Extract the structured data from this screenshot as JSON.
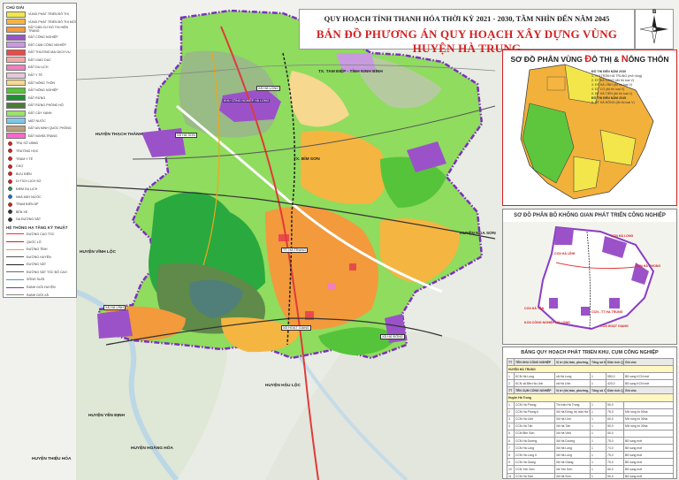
{
  "title": {
    "line1": "QUY HOẠCH TỈNH THANH HÓA THỜI KỲ 2021 - 2030, TẦM NHÌN ĐẾN NĂM 2045",
    "line2": "BẢN ĐỒ PHƯƠNG ÁN QUY HOẠCH XÂY DỰNG VÙNG HUYỆN HÀ TRUNG"
  },
  "compass": {
    "letter": "B"
  },
  "legend": {
    "heading": "CHÚ GIẢI",
    "zones": [
      {
        "label": "VÙNG PHÁT TRIỂN ĐÔ THỊ",
        "color": "#f2e64b"
      },
      {
        "label": "VÙNG PHÁT TRIỂN ĐÔ THỊ MỚI",
        "color": "#f5b541"
      },
      {
        "label": "ĐẤT DÂN CƯ ĐÔ THỊ HIỆN TRẠNG",
        "color": "#f29a3c"
      },
      {
        "label": "ĐẤT CÔNG NGHIỆP",
        "color": "#9b52c9"
      },
      {
        "label": "ĐẤT CỤM CÔNG NGHIỆP",
        "color": "#c99ae0"
      },
      {
        "label": "ĐẤT THƯƠNG MẠI DỊCH VỤ",
        "color": "#e94b4b"
      },
      {
        "label": "ĐẤT GIÁO DỤC",
        "color": "#f4a7a7"
      },
      {
        "label": "ĐẤT DU LỊCH",
        "color": "#f07fbd"
      },
      {
        "label": "ĐẤT Y TẾ",
        "color": "#e7c7d8"
      },
      {
        "label": "ĐẤT NÔNG THÔN",
        "color": "#f6d88f"
      },
      {
        "label": "ĐẤT NÔNG NGHIỆP",
        "color": "#55c43a"
      },
      {
        "label": "ĐẤT RỪNG",
        "color": "#1f8f33"
      },
      {
        "label": "ĐẤT RỪNG PHÒNG HỘ",
        "color": "#4f7a3a"
      },
      {
        "label": "ĐẤT CÂY XANH",
        "color": "#9be36a"
      },
      {
        "label": "MẶT NƯỚC",
        "color": "#7ec8e8"
      },
      {
        "label": "ĐẤT AN NINH QUỐC PHÒNG",
        "color": "#b9a07a"
      },
      {
        "label": "ĐẤT NGHĨA TRANG",
        "color": "#ff66cc"
      }
    ],
    "symbols": [
      {
        "label": "TRỤ SỞ UBND",
        "color": "#d42121"
      },
      {
        "label": "TRƯỜNG HỌC",
        "color": "#d42121"
      },
      {
        "label": "TRẠM Y TẾ",
        "color": "#d42121"
      },
      {
        "label": "CHỢ",
        "color": "#d42121"
      },
      {
        "label": "BƯU ĐIỆN",
        "color": "#d42121"
      },
      {
        "label": "DI TÍCH LỊCH SỬ",
        "color": "#d42121"
      },
      {
        "label": "ĐIỂM DU LỊCH",
        "color": "#2e8b57"
      },
      {
        "label": "NHÀ MÁY NƯỚC",
        "color": "#1c6fd6"
      },
      {
        "label": "TRẠM BIẾN ÁP",
        "color": "#d42121"
      },
      {
        "label": "BẾN XE",
        "color": "#333333"
      },
      {
        "label": "GA ĐƯỜNG SẮT",
        "color": "#333333"
      }
    ],
    "lines_heading": "HỆ THỐNG HẠ TẦNG KỸ THUẬT",
    "lines": [
      {
        "label": "ĐƯỜNG CAO TỐC",
        "color": "#ff2d2d"
      },
      {
        "label": "QUỐC LỘ",
        "color": "#d42121"
      },
      {
        "label": "ĐƯỜNG TỈNH",
        "color": "#f2a51a"
      },
      {
        "label": "ĐƯỜNG HUYỆN",
        "color": "#555555"
      },
      {
        "label": "ĐƯỜNG SẮT",
        "color": "#222222"
      },
      {
        "label": "ĐƯỜNG SẮT TỐC ĐỘ CAO",
        "color": "#6a6a6a"
      },
      {
        "label": "SÔNG SUỐI",
        "color": "#3aa0d8"
      },
      {
        "label": "RANH GIỚI HUYỆN",
        "color": "#7d2fbf"
      },
      {
        "label": "RANH GIỚI XÃ",
        "color": "#888888"
      }
    ]
  },
  "map_labels": {
    "tam_diep": "TX. TAM ĐIỆP - TỈNH NINH BÌNH",
    "thach_thanh": "HUYỆN THẠCH THÀNH",
    "bim_son": "TX. BỈM SƠN",
    "nga_son": "HUYỆN NGA SƠN",
    "vinh_loc": "HUYỆN VĨNH LỘC",
    "yen_dinh": "HUYỆN YÊN ĐỊNH",
    "hau_loc": "HUYỆN HẬU LỘC",
    "hoang_hoa": "HUYỆN HOẰNG HÓA",
    "thieu_hoa": "HUYỆN THIỆU HÓA",
    "ha_long_kcn": "KHU CÔNG NGHIỆP HÀ LONG",
    "ha_long": "XÃ HÀ LONG",
    "ha_linh": "XÃ HÀ LĨNH",
    "ha_trung": "TT. HÀ TRUNG",
    "hoat_giang": "XÃ HOẠT GIANG",
    "ha_son": "XÃ HÀ SƠN",
    "ha_dong": "XÃ HÀ ĐÔNG"
  },
  "inset1": {
    "title_part1": "SƠ ĐỒ PHÂN VÙNG ",
    "title_do": "Đ",
    "title_part2": "Ô THỊ & ",
    "title_n": "N",
    "title_part3": "ÔNG THÔN",
    "legend": [
      "ĐÔ THỊ ĐẾN NĂM 2030",
      "1. THỊ TRẤN HÀ TRUNG (mở rộng)",
      "2. ĐT HÀ LONG (đô thị loại V)",
      "3. ĐT HÀ LĨNH (đô thị loại V)",
      "4. ĐT CỔ (đô thị loại V)",
      "5. ĐT HÀ TIẾN (đô thị loại V)",
      "ĐÔ THỊ ĐẾN NĂM 2045",
      "6. ĐT HÀ ĐÔNG (đô thị loại V)"
    ]
  },
  "inset2": {
    "title": "SƠ ĐỒ PHÂN BỐ KHÔNG GIAN PHÁT TRIỂN CÔNG NGHIỆP",
    "labels": [
      "KCN HÀ LONG",
      "CCN HÀ LĨNH",
      "CCN HÀ PHONG",
      "CCN HÀ TÂN",
      "CCN - TT HÀ TRUNG",
      "KCN CÔNG NGHIỆP HÀ LONG",
      "CCN HOẠT GIANG"
    ]
  },
  "table": {
    "title": "BẢNG QUY HOẠCH PHÁT TRIỂN KHU, CỤM CÔNG NGHIỆP",
    "head1": [
      "TT",
      "TÊN KHU CÔNG NGHIỆP",
      "Vị trí (thị trấn, phường, xã)",
      "Tổng số KCN",
      "Diện tích QH (ha)",
      "Ghi chú"
    ],
    "group1": "HUYỆN HÀ TRUNG",
    "rows1": [
      [
        "1",
        "KCN Hà Long",
        "xã Hà Long",
        "1",
        "550,0",
        "Bổ sung KCN mới"
      ],
      [
        "2",
        "KCN xã Bỉm Hà Lĩnh",
        "xã Hà Lĩnh",
        "1",
        "420,0",
        "Bổ sung KCN mới"
      ]
    ],
    "head2": [
      "TT",
      "TÊN CỤM CÔNG NGHIỆP",
      "Vị trí (thị trấn, phường, xã)",
      "Tổng số CCN",
      "Diện tích QH (ha)",
      "Ghi chú"
    ],
    "group2": "Huyện Hà Trung",
    "rows2": [
      [
        "1",
        "CCN Hà Phong",
        "Thị trấn Hà Trung",
        "1",
        "50,0",
        ""
      ],
      [
        "2",
        "CCN Hà Phong II",
        "Xã Hà Đông, thị trấn Hà Trung",
        "1",
        "75,0",
        "Mở rộng từ 50ha"
      ],
      [
        "3",
        "CCN Hà Lĩnh",
        "Xã Hà Lĩnh",
        "1",
        "60,0",
        "Mở rộng từ 30ha"
      ],
      [
        "4",
        "CCN Hà Tân",
        "Xã Hà Tân",
        "1",
        "50,0",
        "Mở rộng từ 30ha"
      ],
      [
        "5",
        "CCN Bỉm Sơn",
        "Xã Hà Vinh",
        "1",
        "50,0",
        ""
      ],
      [
        "6",
        "CCN Hà Dương",
        "Xã Hà Dương",
        "1",
        "75,0",
        "Bổ sung mới"
      ],
      [
        "7",
        "CCN Hà Long",
        "Xã Hà Long",
        "1",
        "74,0",
        "Bổ sung mới"
      ],
      [
        "8",
        "CCN Hà Long II",
        "Xã Hà Long",
        "1",
        "75,0",
        "Bổ sung mới"
      ],
      [
        "9",
        "CCN Hà Giang",
        "Xã Hà Giang",
        "1",
        "70,0",
        "Bổ sung mới"
      ],
      [
        "10",
        "CCN Yến Sơn",
        "Xã Yến Sơn",
        "1",
        "50,0",
        "Bổ sung mới"
      ],
      [
        "11",
        "CCN Hà Sơn",
        "Xã Hà Sơn",
        "1",
        "50,0",
        "Bổ sung mới"
      ],
      [
        "12",
        "CCN Hà Tiến",
        "Xã Hà Tiến",
        "1",
        "50,0",
        "Bổ sung mới"
      ]
    ]
  }
}
